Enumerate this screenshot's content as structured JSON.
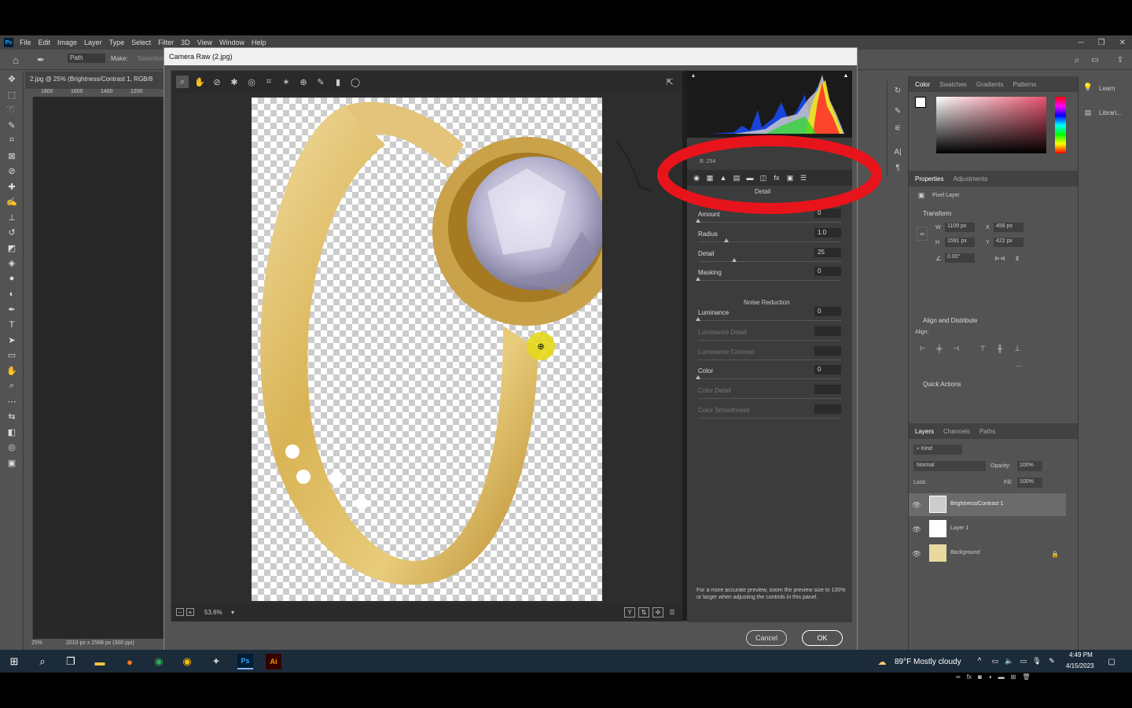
{
  "photoshop": {
    "menus": [
      "File",
      "Edit",
      "Image",
      "Layer",
      "Type",
      "Select",
      "Filter",
      "3D",
      "View",
      "Window",
      "Help"
    ],
    "options_bar": {
      "mode": "Path",
      "make": "Make:",
      "selection": "Selection..."
    },
    "doc_tab": "2.jpg @ 25% (Brightness/Contrast 1, RGB/8",
    "ruler_top": [
      "1800",
      "1600",
      "1400",
      "1200"
    ],
    "status": {
      "zoom": "25%",
      "doc_info": "2010 px x 2568 px (300 ppi)"
    }
  },
  "camera_raw": {
    "title": "Camera Raw (2.jpg)",
    "zoom": "53.6%",
    "histogram_readout": "B:  254",
    "section_header": "Detail",
    "sharpening": [
      {
        "label": "Amount",
        "value": "0",
        "pos": 0.0
      },
      {
        "label": "Radius",
        "value": "1.0",
        "pos": 0.2
      },
      {
        "label": "Detail",
        "value": "25",
        "pos": 0.25
      },
      {
        "label": "Masking",
        "value": "0",
        "pos": 0.0
      }
    ],
    "noise_reduction_title": "Noise Reduction",
    "noise": [
      {
        "label": "Luminance",
        "value": "0",
        "dim": false,
        "pos": 0.0
      },
      {
        "label": "Luminance Detail",
        "value": "",
        "dim": true
      },
      {
        "label": "Luminance Contrast",
        "value": "",
        "dim": true
      },
      {
        "label": "Color",
        "value": "0",
        "dim": false,
        "pos": 0.0
      },
      {
        "label": "Color Detail",
        "value": "",
        "dim": true
      },
      {
        "label": "Color Smoothness",
        "value": "",
        "dim": true
      }
    ],
    "footer_note": "For a more accurate preview, zoom the preview size to 100% or larger when adjusting the controls in this panel.",
    "cancel_label": "Cancel",
    "ok_label": "OK"
  },
  "panels": {
    "color_tabs": [
      "Color",
      "Swatches",
      "Gradients",
      "Patterns"
    ],
    "properties_tabs": [
      "Properties",
      "Adjustments"
    ],
    "pixel_layer": "Pixel Layer",
    "transform_title": "Transform",
    "transform": {
      "w": "1109 px",
      "x": "456 px",
      "h": "1591 px",
      "y": "422 px",
      "angle": "0.00°"
    },
    "align_title": "Align and Distribute",
    "align_label": "Align:",
    "quick_actions": "Quick Actions",
    "layers_tabs": [
      "Layers",
      "Channels",
      "Paths"
    ],
    "kind": "Kind",
    "blend_mode": "Normal",
    "opacity_label": "Opacity:",
    "opacity": "100%",
    "lock_label": "Lock:",
    "fill_label": "Fill:",
    "fill": "100%",
    "layers": [
      {
        "name": "Brightness/Contrast 1",
        "selected": true
      },
      {
        "name": "Layer 1",
        "selected": false
      },
      {
        "name": "Background",
        "selected": false
      }
    ],
    "learn": "Learn",
    "libraries": "Librari..."
  },
  "taskbar": {
    "weather": "89°F  Mostly cloudy",
    "time": "4:49 PM",
    "date": "4/15/2023"
  },
  "colors": {
    "annotation_red": "#e8141b",
    "cursor_highlight": "#e6d81a"
  }
}
